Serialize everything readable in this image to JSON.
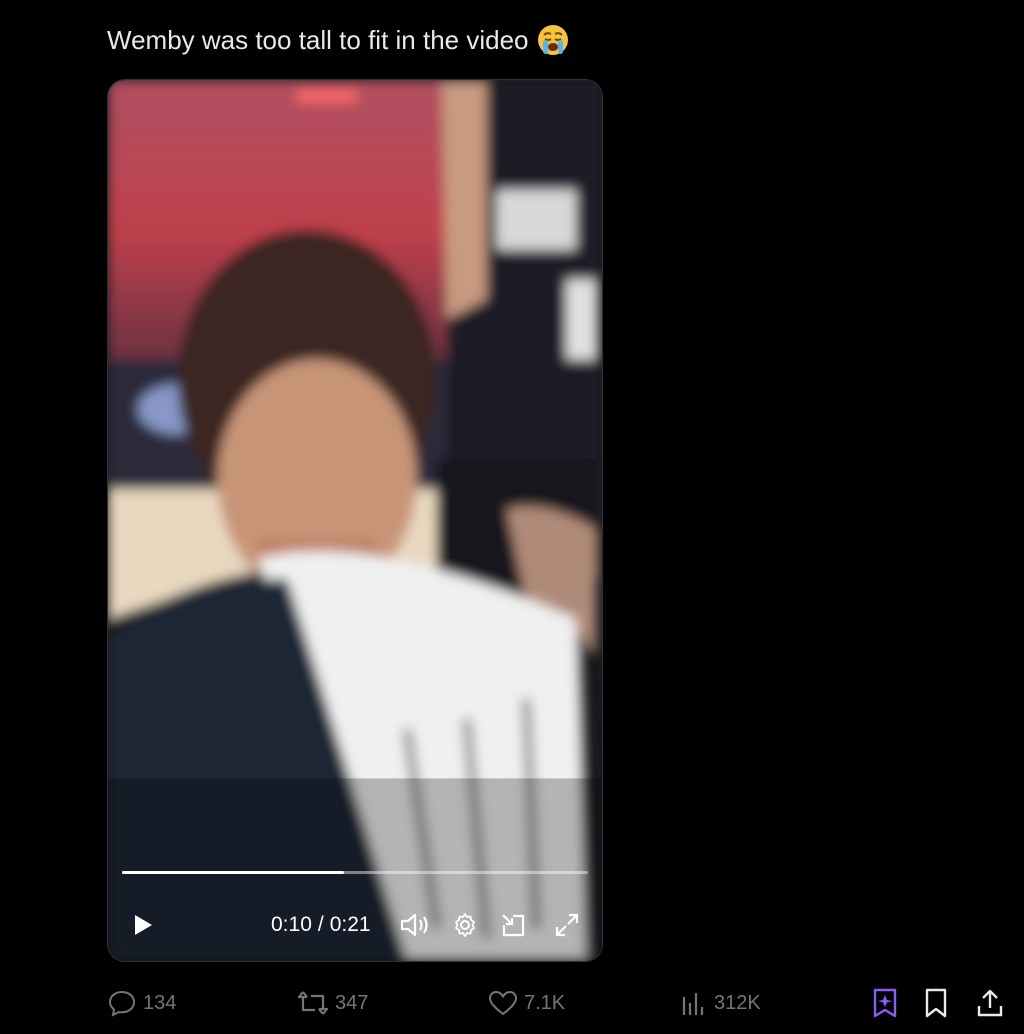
{
  "tweet": {
    "text": "Wemby was too tall to fit in the video",
    "emoji": "loudly-crying-face"
  },
  "video": {
    "time_current": "0:10",
    "time_total": "0:21",
    "time_separator": "/",
    "progress_fraction": 0.476,
    "controls": [
      "play-icon",
      "volume-icon",
      "settings-gear-icon",
      "pip-icon",
      "fullscreen-icon"
    ]
  },
  "actions": {
    "replies": "134",
    "reposts": "347",
    "likes": "7.1K",
    "views": "312K"
  },
  "colors": {
    "background": "#000000",
    "text": "#e7e9ea",
    "muted": "#71767b",
    "grok_accent": "#8b5cf6"
  }
}
